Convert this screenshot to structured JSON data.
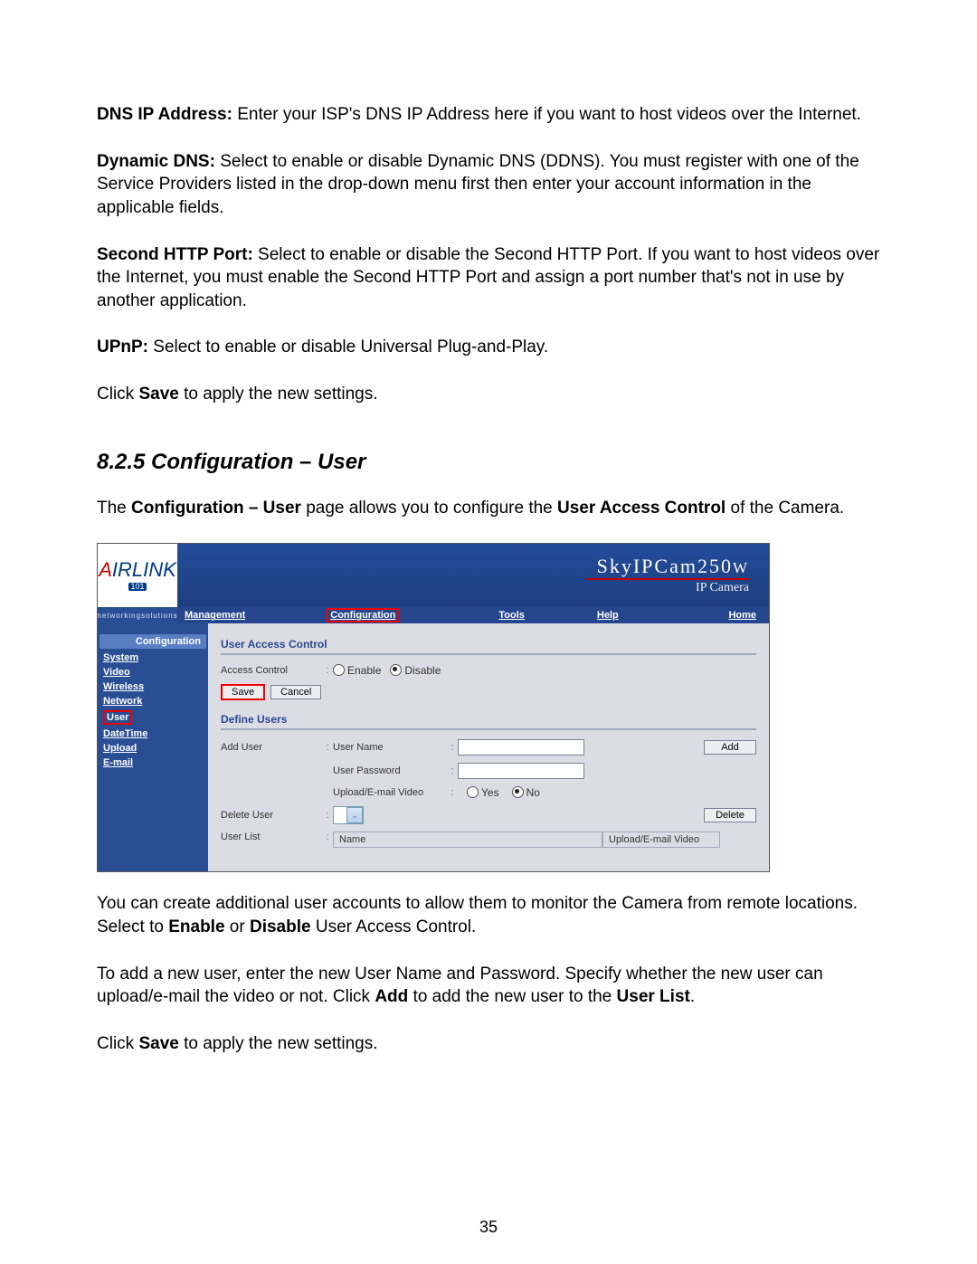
{
  "paragraphs": {
    "dns_label": "DNS IP Address:",
    "dns_text": " Enter your ISP's DNS IP Address here if you want to host videos over the Internet.",
    "ddns_label": "Dynamic DNS:",
    "ddns_text": " Select to enable or disable Dynamic DNS (DDNS). You must register with one of the Service Providers listed in the drop-down menu first then enter your account information in the applicable fields.",
    "http_label": "Second HTTP Port:",
    "http_text": " Select to enable or disable the Second HTTP Port. If you want to host videos over the Internet, you must enable the Second HTTP Port and assign a port number that's not in use by another application.",
    "upnp_label": "UPnP:",
    "upnp_text": " Select to enable or disable Universal Plug-and-Play.",
    "click1_a": "Click ",
    "click1_b": "Save",
    "click1_c": " to apply the new settings.",
    "section_title": "8.2.5 Configuration – User",
    "intro_a": "The ",
    "intro_b": "Configuration – User",
    "intro_c": " page allows you to configure the ",
    "intro_d": "User Access Control",
    "intro_e": " of the Camera.",
    "after_a": "You can create additional user accounts to allow them to monitor the Camera from remote locations. Select to ",
    "after_b": "Enable",
    "after_c": " or ",
    "after_d": "Disable",
    "after_e": " User Access Control.",
    "add_a": "To add a new user, enter the new User Name and Password. Specify whether the new user can upload/e-mail the video or not. Click ",
    "add_b": "Add",
    "add_c": " to add the new user to the ",
    "add_d": "User List",
    "add_e": ".",
    "click2_a": "Click ",
    "click2_b": "Save",
    "click2_c": " to apply the new settings."
  },
  "page_number": "35",
  "shot": {
    "logo_tag": "networkingsolutions",
    "brand_top": "SkyIPCam250",
    "brand_w": "W",
    "brand_sub": "IP Camera",
    "nav": {
      "management": "Management",
      "configuration": "Configuration",
      "tools": "Tools",
      "help": "Help",
      "home": "Home"
    },
    "sidebar": {
      "head": "Configuration",
      "system": "System",
      "video": "Video",
      "wireless": "Wireless",
      "network": "Network",
      "user": "User",
      "datetime": "DateTime",
      "upload": "Upload",
      "email": "E-mail"
    },
    "content": {
      "uac_header": "User Access Control",
      "access_control": "Access Control",
      "enable": "Enable",
      "disable": "Disable",
      "save": "Save",
      "cancel": "Cancel",
      "define_users": "Define Users",
      "add_user": "Add User",
      "user_name": "User Name",
      "user_password": "User Password",
      "upload_email_video": "Upload/E-mail Video",
      "yes": "Yes",
      "no": "No",
      "add": "Add",
      "delete_user": "Delete User",
      "delete": "Delete",
      "user_list": "User List",
      "th_name": "Name",
      "th_upload": "Upload/E-mail Video"
    }
  }
}
